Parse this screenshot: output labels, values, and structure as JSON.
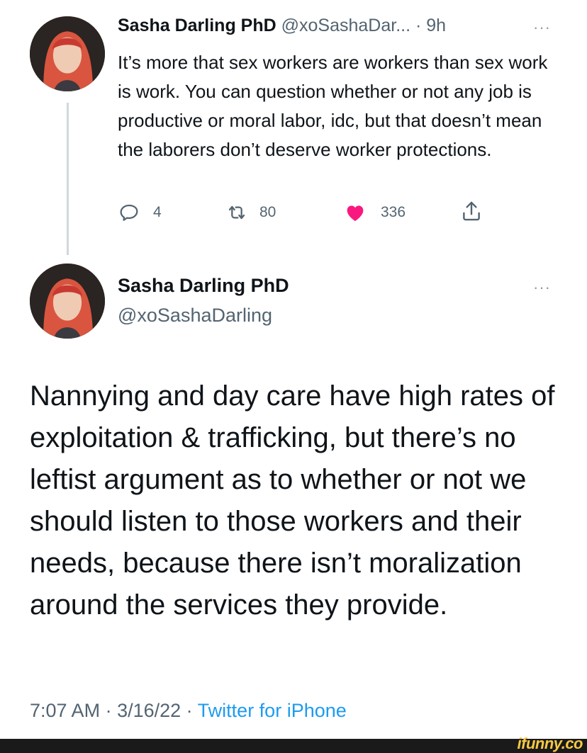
{
  "tweet1": {
    "name": "Sasha Darling PhD",
    "handle": "@xoSashaDar...",
    "separator": " · ",
    "time": "9h",
    "more": "···",
    "text": "It’s more that sex workers are workers than sex work is work. You can question whether or not any job is productive or moral labor, idc, but that doesn’t mean the laborers don’t deserve worker protections.",
    "replies": "4",
    "retweets": "80",
    "likes": "336",
    "like_color": "#f91880"
  },
  "tweet2": {
    "name": "Sasha Darling PhD",
    "handle": "@xoSashaDarling",
    "more": "···",
    "text": "Nannying and day care have high rates of exploitation & trafficking, but there’s no leftist argument as to whether or not we should listen to those workers and their needs, because there isn’t moralization around the services they provide.",
    "time": "7:07 AM",
    "date": "3/16/22",
    "separator": " · ",
    "client": "Twitter for iPhone",
    "link_color": "#1d9bf0"
  },
  "watermark": "ifunny.co"
}
